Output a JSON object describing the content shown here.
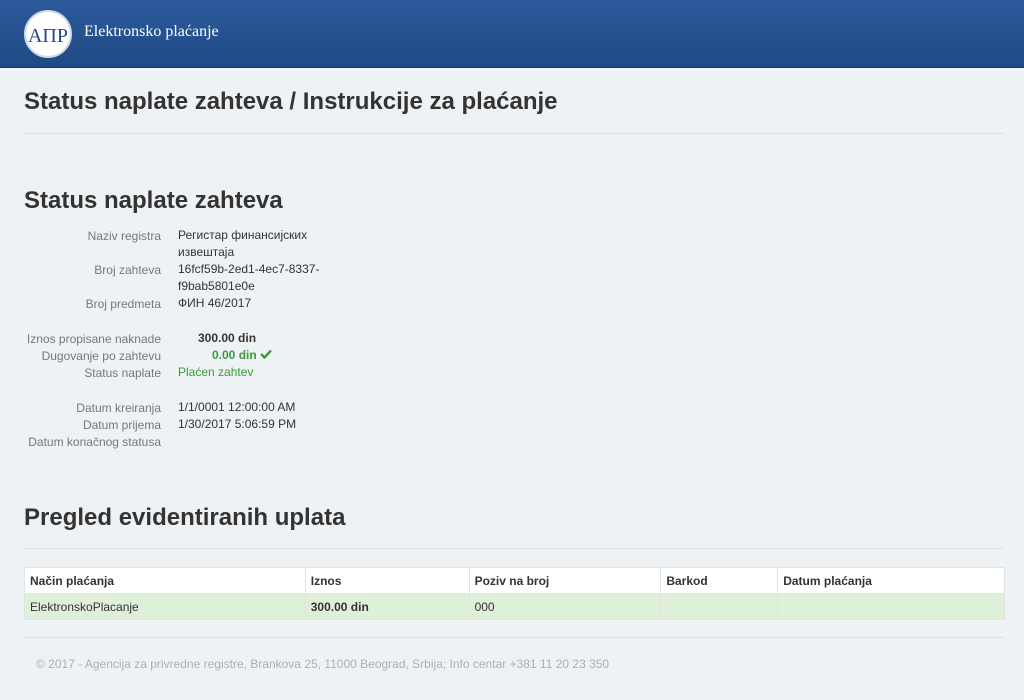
{
  "header": {
    "logo_text": "АПР",
    "brand": "Elektronsko plaćanje"
  },
  "page_title": "Status naplate zahteva / Instrukcije za plaćanje",
  "status_section": {
    "title": "Status naplate zahteva",
    "naziv_registra_label": "Naziv registra",
    "naziv_registra_line1": "Регистар финансијских",
    "naziv_registra_line2": "извештаја",
    "broj_zahteva_label": "Broj zahteva",
    "broj_zahteva_line1": "16fcf59b-2ed1-4ec7-8337-",
    "broj_zahteva_line2": "f9bab5801e0e",
    "broj_predmeta_label": "Broj predmeta",
    "broj_predmeta": "ФИН 46/2017",
    "iznos_label": "Iznos propisane naknade",
    "iznos": "300.00 din",
    "dugovanje_label": "Dugovanje po zahtevu",
    "dugovanje": "0.00 din",
    "status_label": "Status naplate",
    "status": "Plaćen zahtev",
    "datum_kreiranja_label": "Datum kreiranja",
    "datum_kreiranja": "1/1/0001 12:00:00 AM",
    "datum_prijema_label": "Datum prijema",
    "datum_prijema": "1/30/2017 5:06:59 PM",
    "datum_konacnog_label": "Datum konačnog statusa",
    "success_color": "#3c9a3c"
  },
  "payments_section": {
    "title": "Pregled evidentiranih uplata",
    "columns": [
      "Način plaćanja",
      "Iznos",
      "Poziv na broj",
      "Barkod",
      "Datum plaćanja"
    ],
    "rows": [
      [
        "ElektronskoPlacanje",
        "300.00 din",
        "000",
        "",
        ""
      ]
    ]
  },
  "footer": "© 2017 - Agencija za privredne registre, Brankova 25, 11000 Beograd, Srbija; Info centar +381 11 20 23 350"
}
